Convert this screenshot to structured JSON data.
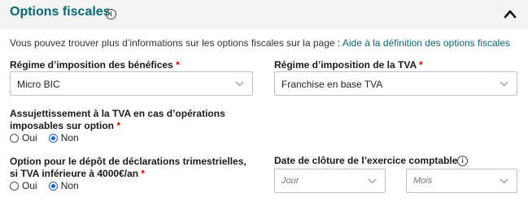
{
  "header": {
    "title": "Options fiscales",
    "info_icon": "info-icon",
    "collapse_icon": "chevron-up-icon"
  },
  "intro": {
    "text": "Vous pouvez trouver plus d’informations sur les options fiscales sur la page : ",
    "link": "Aide à la définition des options fiscales"
  },
  "regime_benefices": {
    "label": "Régime d’imposition des bénéfices",
    "required": "*",
    "value": "Micro BIC"
  },
  "regime_tva": {
    "label": "Régime d’imposition de la TVA",
    "required": "*",
    "value": "Franchise en base TVA"
  },
  "assujettissement": {
    "label_line1": "Assujettissement à la TVA en cas d’opérations",
    "label_line2": "imposables sur option",
    "required": "*",
    "options": [
      "Oui",
      "Non"
    ],
    "selected": "Non"
  },
  "depot_trimestriel": {
    "label_line1": "Option pour le dépôt de déclarations trimestrielles,",
    "label_line2": "si TVA inférieure à 4000€/an",
    "required": "*",
    "options": [
      "Oui",
      "Non"
    ],
    "selected": "Non"
  },
  "date_cloture": {
    "label": "Date de clôture de l’exercice comptable",
    "jour_placeholder": "Jour",
    "mois_placeholder": "Mois"
  },
  "colors": {
    "accent": "#0a6673",
    "required": "#d40000",
    "radio_checked": "#1f5fd0"
  }
}
